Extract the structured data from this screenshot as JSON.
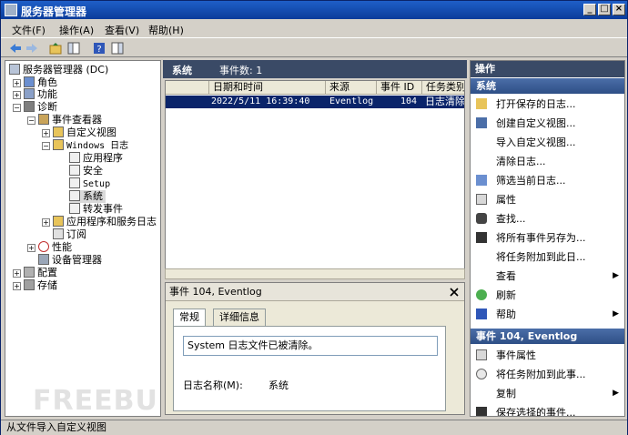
{
  "window": {
    "title": "服务器管理器",
    "controls": {
      "minimize": "_",
      "maximize": "□",
      "close": "×"
    }
  },
  "menu": [
    "文件(F)",
    "操作(A)",
    "查看(V)",
    "帮助(H)"
  ],
  "tree": {
    "root": "服务器管理器 (DC)",
    "roles": "角色",
    "features": "功能",
    "diagnostics": "诊断",
    "event_viewer": "事件查看器",
    "custom_views": "自定义视图",
    "windows_logs": "Windows 日志",
    "application": "应用程序",
    "security": "安全",
    "setup": "Setup",
    "system": "系统",
    "forwarded": "转发事件",
    "app_service_logs": "应用程序和服务日志",
    "subscriptions": "订阅",
    "performance": "性能",
    "device_manager": "设备管理器",
    "configuration": "配置",
    "storage": "存储"
  },
  "middle": {
    "title": "系统",
    "event_count": "事件数: 1",
    "columns": [
      "日期和时间",
      "来源",
      "事件 ID",
      "任务类别"
    ],
    "rows": [
      {
        "datetime": "2022/5/11 16:39:40",
        "source": "Eventlog",
        "event_id": "104",
        "category": "日志清除"
      }
    ]
  },
  "detail": {
    "header": "事件 104, Eventlog",
    "tab_general": "常规",
    "tab_details": "详细信息",
    "message": "System 日志文件已被清除。",
    "log_name_label": "日志名称(M):",
    "log_name_value": "系统"
  },
  "actions": {
    "header": "操作",
    "section_system": "系统",
    "items": [
      "打开保存的日志...",
      "创建自定义视图...",
      "导入自定义视图...",
      "清除日志...",
      "筛选当前日志...",
      "属性",
      "查找...",
      "将所有事件另存为...",
      "将任务附加到此日...",
      "查看",
      "刷新",
      "帮助"
    ],
    "section_event": "事件 104, Eventlog",
    "event_items": [
      "事件属性",
      "将任务附加到此事...",
      "复制",
      "保存选择的事件..."
    ]
  },
  "status": "从文件导入自定义视图",
  "watermark": "FREEBUF"
}
